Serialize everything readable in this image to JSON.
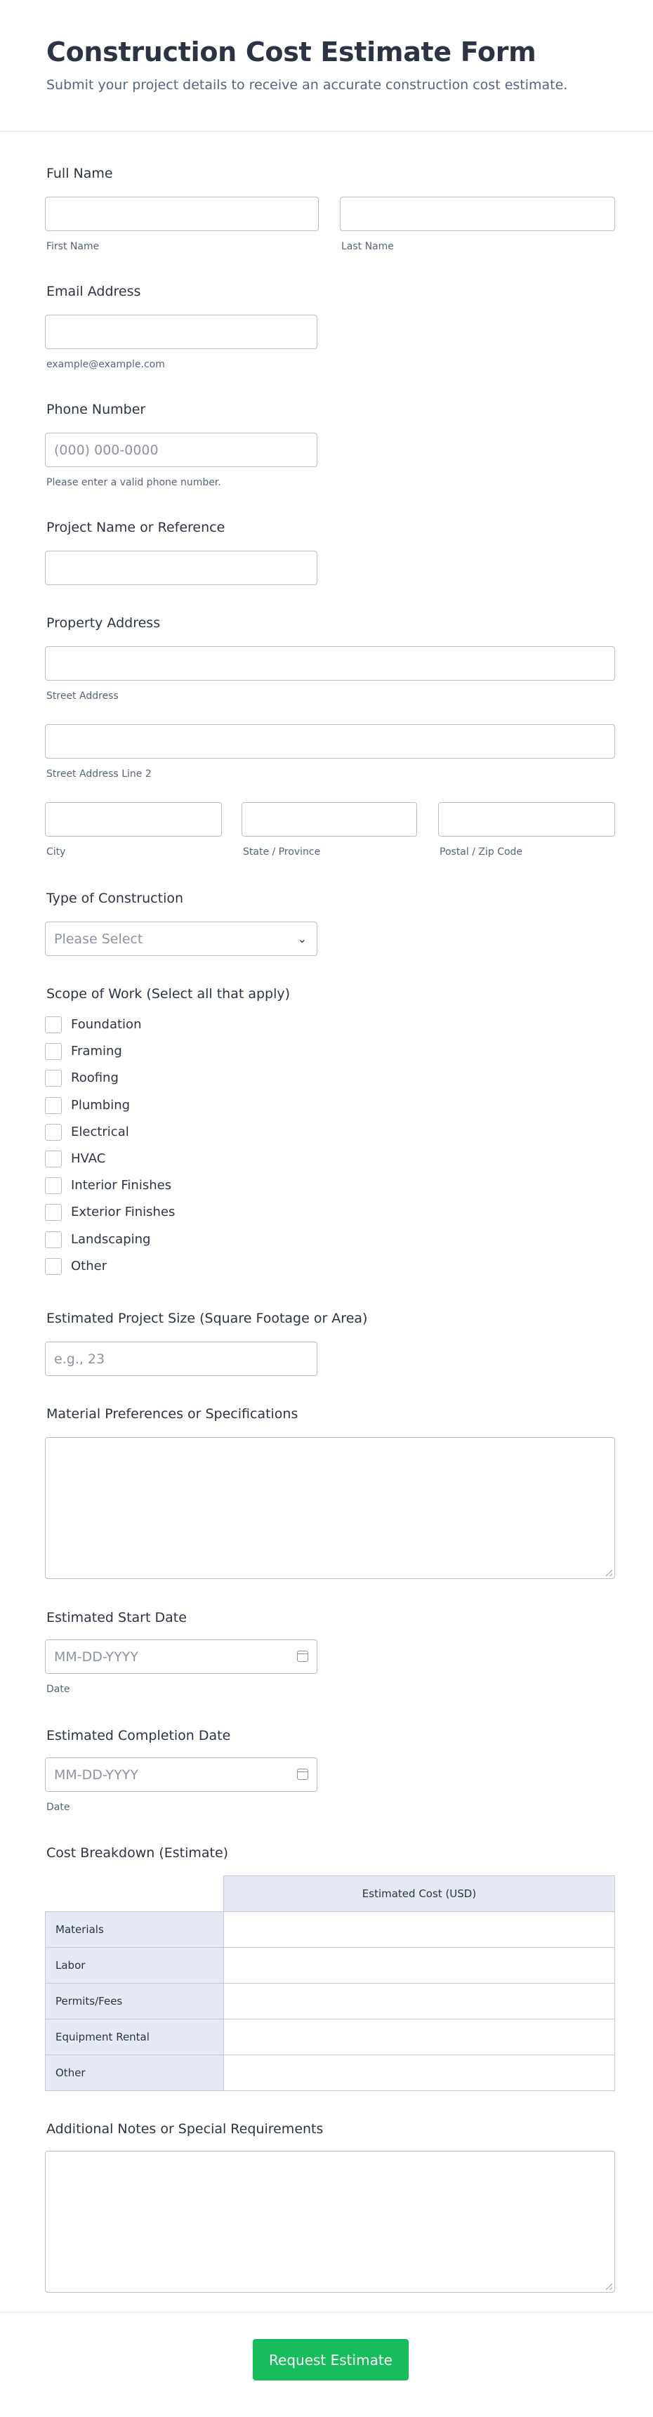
{
  "header": {
    "title": "Construction Cost Estimate Form",
    "subtitle": "Submit your project details to receive an accurate construction cost estimate."
  },
  "full_name": {
    "label": "Full Name",
    "first_sublabel": "First Name",
    "last_sublabel": "Last Name"
  },
  "email": {
    "label": "Email Address",
    "sublabel": "example@example.com"
  },
  "phone": {
    "label": "Phone Number",
    "placeholder": "(000) 000-0000",
    "sublabel": "Please enter a valid phone number."
  },
  "project_name": {
    "label": "Project Name or Reference"
  },
  "address": {
    "label": "Property Address",
    "street_sublabel": "Street Address",
    "street2_sublabel": "Street Address Line 2",
    "city_sublabel": "City",
    "state_sublabel": "State / Province",
    "postal_sublabel": "Postal / Zip Code"
  },
  "construction_type": {
    "label": "Type of Construction",
    "selected": "Please Select"
  },
  "scope": {
    "label": "Scope of Work (Select all that apply)",
    "options": [
      "Foundation",
      "Framing",
      "Roofing",
      "Plumbing",
      "Electrical",
      "HVAC",
      "Interior Finishes",
      "Exterior Finishes",
      "Landscaping",
      "Other"
    ]
  },
  "project_size": {
    "label": "Estimated Project Size (Square Footage or Area)",
    "placeholder": "e.g., 23"
  },
  "materials": {
    "label": "Material Preferences or Specifications"
  },
  "start_date": {
    "label": "Estimated Start Date",
    "placeholder": "MM-DD-YYYY",
    "sublabel": "Date"
  },
  "completion_date": {
    "label": "Estimated Completion Date",
    "placeholder": "MM-DD-YYYY",
    "sublabel": "Date"
  },
  "cost_breakdown": {
    "label": "Cost Breakdown (Estimate)",
    "column": "Estimated Cost (USD)",
    "rows": [
      "Materials",
      "Labor",
      "Permits/Fees",
      "Equipment Rental",
      "Other"
    ]
  },
  "notes": {
    "label": "Additional Notes or Special Requirements"
  },
  "submit": {
    "label": "Request Estimate"
  },
  "colors": {
    "primary_text": "#2c3345",
    "secondary_text": "#57647e",
    "submit_button": "#18bd5b",
    "matrix_header": "#e5e9f4"
  }
}
